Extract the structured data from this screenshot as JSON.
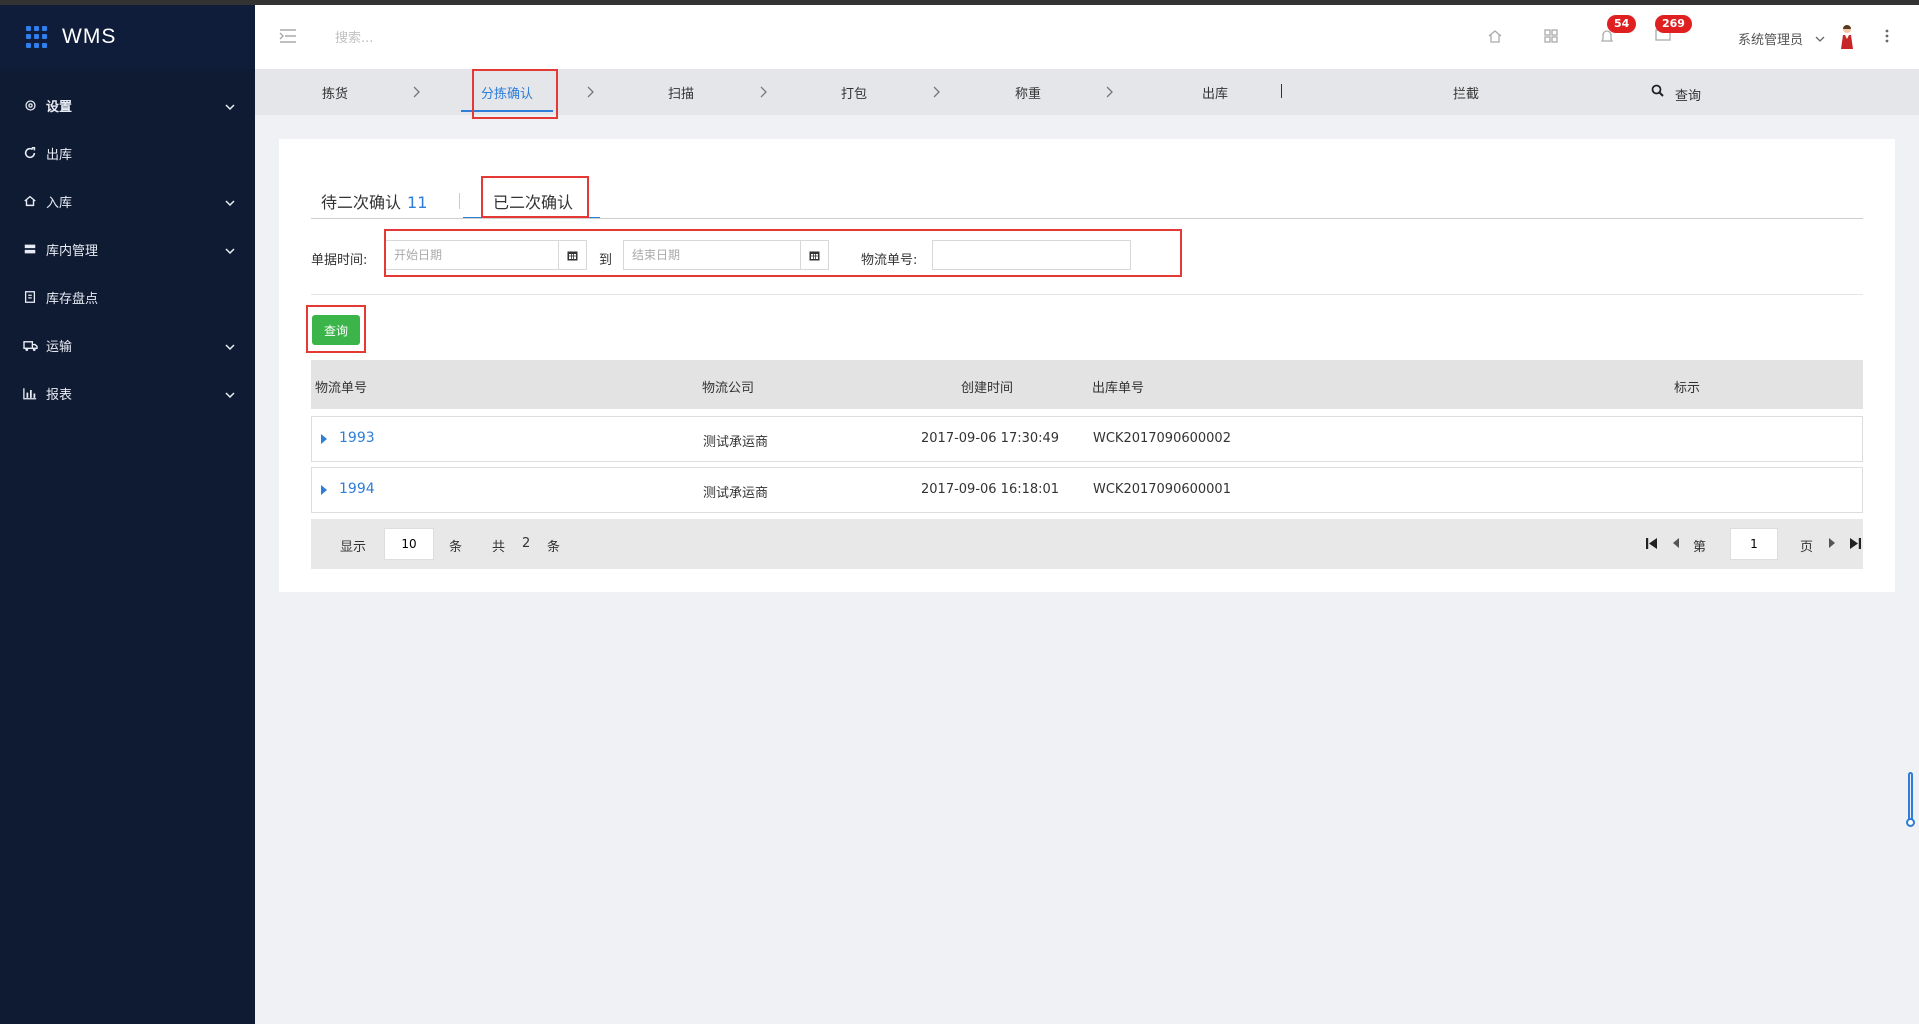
{
  "app": {
    "title": "WMS"
  },
  "sidebar": {
    "items": [
      {
        "label": "设置",
        "icon": "gear-icon",
        "expandable": true
      },
      {
        "label": "出库",
        "icon": "outbound-icon",
        "expandable": false
      },
      {
        "label": "入库",
        "icon": "inbound-icon",
        "expandable": true
      },
      {
        "label": "库内管理",
        "icon": "warehouse-icon",
        "expandable": true
      },
      {
        "label": "库存盘点",
        "icon": "inventory-check-icon",
        "expandable": false
      },
      {
        "label": "运输",
        "icon": "truck-icon",
        "expandable": true
      },
      {
        "label": "报表",
        "icon": "bar-chart-icon",
        "expandable": true
      }
    ]
  },
  "header": {
    "search_placeholder": "搜索...",
    "notifications_count": "54",
    "messages_count": "269",
    "user_name": "系统管理员"
  },
  "steps": {
    "items": [
      "拣货",
      "分拣确认",
      "扫描",
      "打包",
      "称重",
      "出库",
      "拦截"
    ],
    "active": "分拣确认",
    "search_label": "查询"
  },
  "tabs": {
    "pending_label": "待二次确认",
    "pending_count": "11",
    "confirmed_label": "已二次确认",
    "active": "已二次确认"
  },
  "filters": {
    "date_label": "单据时间:",
    "start_placeholder": "开始日期",
    "to_label": "到",
    "end_placeholder": "结束日期",
    "tracking_label": "物流单号:",
    "tracking_value": ""
  },
  "query_button": "查询",
  "table": {
    "columns": [
      "物流单号",
      "物流公司",
      "创建时间",
      "出库单号",
      "标示"
    ],
    "rows": [
      {
        "tracking_no": "1993",
        "company": "测试承运商",
        "created": "2017-09-06 17:30:49",
        "outbound_no": "WCK2017090600002",
        "mark": ""
      },
      {
        "tracking_no": "1994",
        "company": "测试承运商",
        "created": "2017-09-06 16:18:01",
        "outbound_no": "WCK2017090600001",
        "mark": ""
      }
    ]
  },
  "pagination": {
    "show_label": "显示",
    "page_size": "10",
    "unit_label": "条",
    "total_label": "共",
    "total": "2",
    "total_unit": "条",
    "page_prefix": "第",
    "current_page": "1",
    "page_suffix": "页"
  },
  "colors": {
    "sidebar_bg": "#0f1a33",
    "accent": "#2e7dd8",
    "query_button": "#3bb54a",
    "badge": "#e02020",
    "annotation_box": "#e53935"
  }
}
